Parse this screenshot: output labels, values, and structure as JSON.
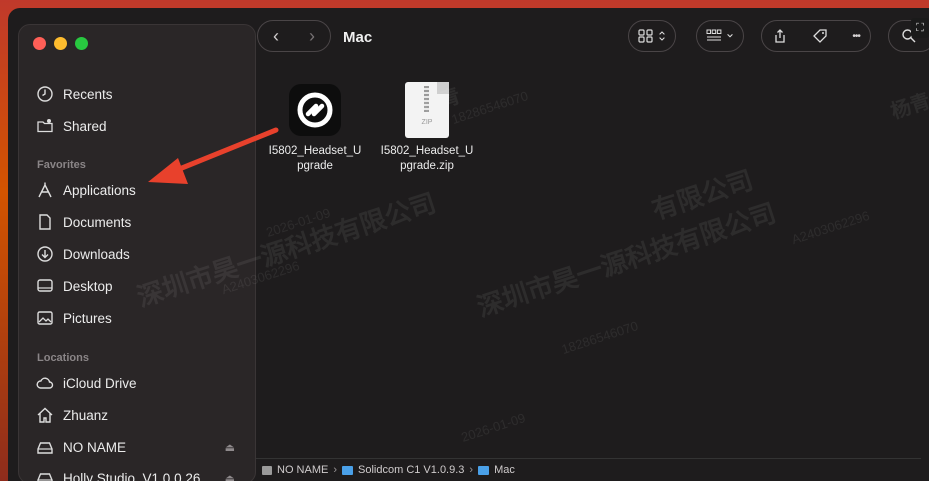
{
  "window": {
    "title": "Mac"
  },
  "sidebar": {
    "sections": {
      "favorites": "Favorites",
      "locations": "Locations"
    },
    "top_items": [
      {
        "label": "Recents",
        "icon": "clock-icon"
      },
      {
        "label": "Shared",
        "icon": "shared-folder-icon"
      }
    ],
    "favorites": [
      {
        "label": "Applications",
        "icon": "applications-icon"
      },
      {
        "label": "Documents",
        "icon": "document-icon"
      },
      {
        "label": "Downloads",
        "icon": "download-icon"
      },
      {
        "label": "Desktop",
        "icon": "desktop-icon"
      },
      {
        "label": "Pictures",
        "icon": "pictures-icon"
      }
    ],
    "locations": [
      {
        "label": "iCloud Drive",
        "icon": "cloud-icon"
      },
      {
        "label": "Zhuanz",
        "icon": "home-icon"
      },
      {
        "label": "NO NAME",
        "icon": "drive-icon",
        "eject": "⏏"
      },
      {
        "label": "Holly Studio_V1.0.0.26",
        "icon": "drive-icon",
        "eject": "⏏"
      }
    ]
  },
  "files": [
    {
      "label": "I5802_Headset_Upgrade",
      "kind": "app"
    },
    {
      "label": "I5802_Headset_Upgrade.zip",
      "kind": "zip",
      "ext": "ZIP"
    }
  ],
  "file_label_lines": [
    [
      "I5802_Headset_U",
      "pgrade"
    ],
    [
      "I5802_Headset_U",
      "pgrade.zip"
    ]
  ],
  "pathbar": {
    "items": [
      "NO NAME",
      "Solidcom C1 V1.0.9.3",
      "Mac"
    ],
    "separator": "›"
  },
  "toolbar": {
    "back": "‹",
    "forward": "›",
    "more": "•••"
  },
  "watermark": {
    "company": "深圳市昊一源科技有限公司",
    "company_short": "有限公司",
    "name": "杨青",
    "id1": "A2403062296",
    "id2": "18286546070",
    "date": "2026-01-09"
  },
  "colors": {
    "window_bg": "#1e1c1d",
    "sidebar_bg": "#2a2627",
    "accent_arrow": "#e8412c",
    "folder_blue": "#4aa0e8"
  }
}
